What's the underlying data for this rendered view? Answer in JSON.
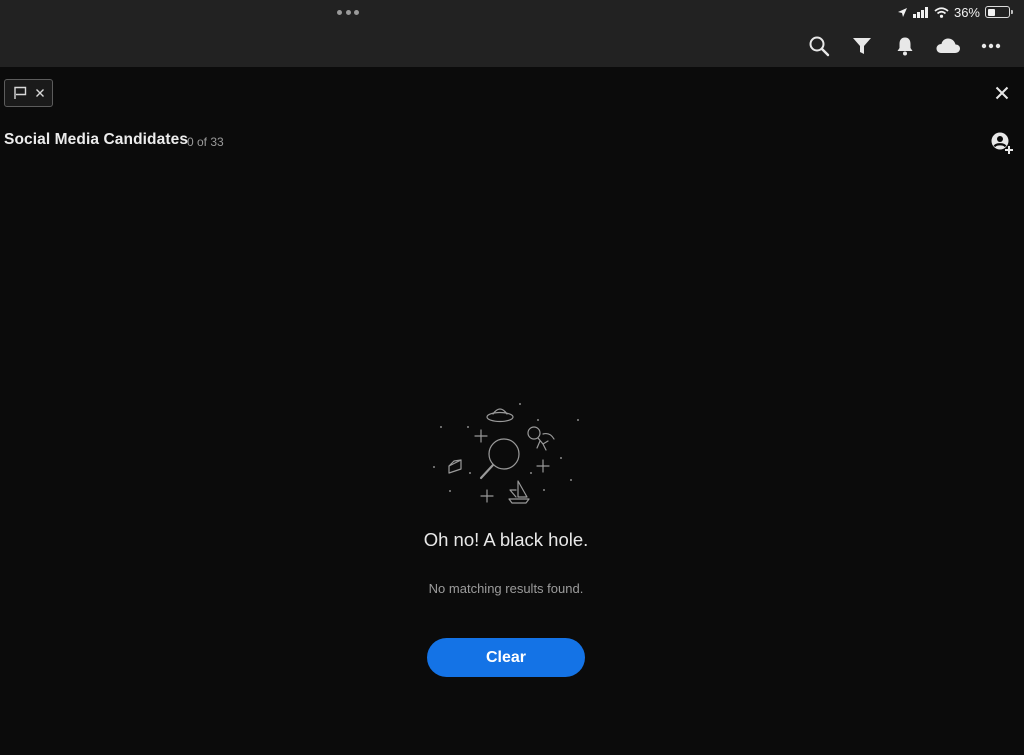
{
  "status_bar": {
    "battery_text": "36%",
    "battery_level": 0.36,
    "icons": [
      "location-icon",
      "signal-icon",
      "wifi-icon",
      "battery-icon"
    ]
  },
  "toolbar": {
    "icons": [
      "search-icon",
      "filter-icon",
      "bell-icon",
      "cloud-icon",
      "more-icon"
    ]
  },
  "filter_chip": {
    "icons": [
      "flag-icon",
      "close-icon"
    ]
  },
  "album": {
    "title": "Social Media Candidates",
    "count": "0 of 33"
  },
  "empty_state": {
    "heading": "Oh no! A black hole.",
    "message": "No matching results found.",
    "button_label": "Clear"
  },
  "colors": {
    "background": "#0b0b0b",
    "topbar": "#222222",
    "accent": "#1473e6"
  }
}
